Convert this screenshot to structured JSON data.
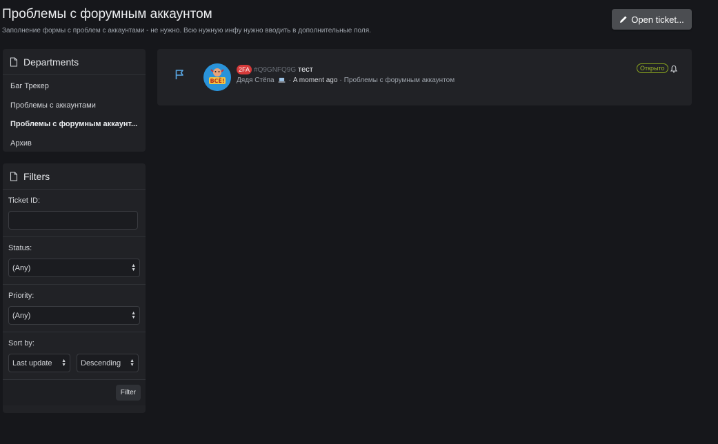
{
  "page": {
    "title": "Проблемы с форумным аккаунтом",
    "description": "Заполнение формы с проблем с аккаунтами - не нужно. Всю нужную инфу нужно вводить в дополнительные поля.",
    "open_ticket_label": "Open ticket..."
  },
  "departments": {
    "header": "Departments",
    "items": [
      {
        "label": "Баг Трекер"
      },
      {
        "label": "Проблемы с аккаунтами"
      },
      {
        "label": "Проблемы с форумным аккаунт..."
      },
      {
        "label": "Архив"
      }
    ],
    "active_index": 2
  },
  "filters": {
    "header": "Filters",
    "ticket_id_label": "Ticket ID:",
    "ticket_id_value": "",
    "status_label": "Status:",
    "status_value": "(Any)",
    "priority_label": "Priority:",
    "priority_value": "(Any)",
    "sort_label": "Sort by:",
    "sort_field_value": "Last update",
    "sort_order_value": "Descending",
    "filter_button": "Filter"
  },
  "ticket": {
    "prefix": "2FA",
    "id": "#Q9GNFQ9G",
    "title": "тест",
    "author": "Дядя Стёпа",
    "author_icon": "laptop-icon",
    "time": "A moment ago",
    "department": "Проблемы с форумным аккаунтом",
    "status": "Открыто",
    "avatar_text": "ВСЁ!"
  },
  "colors": {
    "background": "#16171b",
    "panel": "#212226",
    "prefix_red": "#d63a3a",
    "status_green": "#8aa51e",
    "flag_blue": "#5aa9e6"
  }
}
